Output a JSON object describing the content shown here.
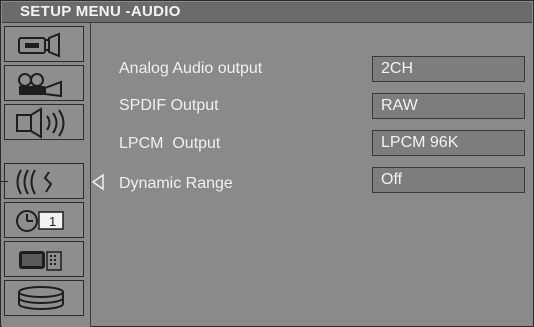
{
  "title": "SETUP MENU -AUDIO",
  "sidebar": {
    "items": [
      {
        "icon": "camera-icon"
      },
      {
        "icon": "projector-icon"
      },
      {
        "icon": "speaker-icon"
      },
      {
        "icon": "audio-wave-icon",
        "active": true
      },
      {
        "icon": "clock-icon",
        "badge": "1"
      },
      {
        "icon": "tv-remote-icon"
      },
      {
        "icon": "disc-stack-icon"
      }
    ]
  },
  "settings": [
    {
      "label": "Analog Audio output",
      "value": "2CH"
    },
    {
      "label": "SPDIF Output",
      "value": "RAW"
    },
    {
      "label": "LPCM  Output",
      "value": "LPCM 96K"
    },
    {
      "label": "Dynamic Range",
      "value": "Off"
    }
  ],
  "colors": {
    "background": "#8a8a8a",
    "title_bar": "#6b6b6b",
    "value_box": "#7d7d7d",
    "text": "#f0f0f0"
  }
}
